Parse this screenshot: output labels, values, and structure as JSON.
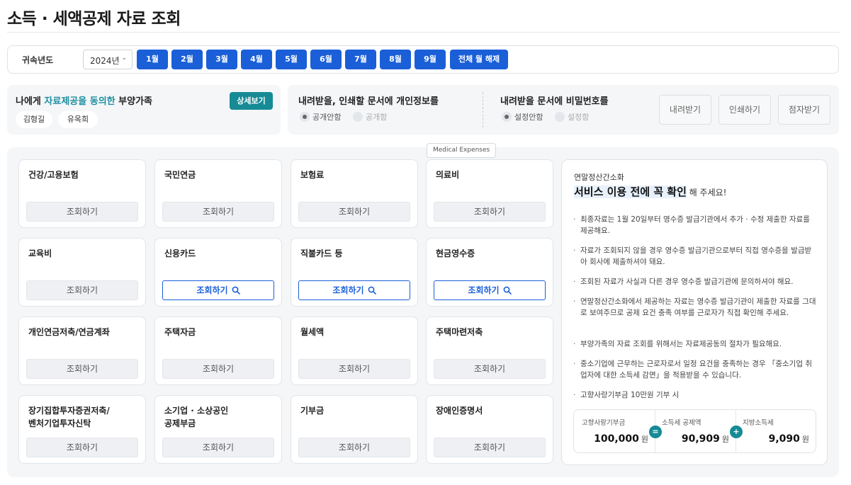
{
  "page": {
    "title": "소득 · 세액공제 자료 조회"
  },
  "yearbar": {
    "label": "귀속년도",
    "year": "2024년",
    "months": [
      "1월",
      "2월",
      "3월",
      "4월",
      "5월",
      "6월",
      "7월",
      "8월",
      "9월"
    ],
    "clear_label": "전체 월 해제",
    "accent": "#1a5fd8"
  },
  "family": {
    "title_prefix": "나에게 ",
    "title_highlight": "자료제공을 동의한",
    "title_suffix": " 부양가족",
    "detail_label": "상세보기",
    "members": [
      "김형길",
      "유옥희"
    ]
  },
  "options": {
    "privacy": {
      "title": "내려받을, 인쇄할 문서에 개인정보를",
      "opt_on": "공개안함",
      "opt_off": "공개함",
      "selected": "공개안함"
    },
    "password": {
      "title": "내려받을 문서에 비밀번호를",
      "opt_on": "설정안함",
      "opt_off": "설정함",
      "selected": "설정안함"
    },
    "download_label": "내려받기",
    "print_label": "인쇄하기",
    "braille_label": "점자받기"
  },
  "categories": [
    {
      "title": "건강/고용보험",
      "button": "조회하기",
      "active": false
    },
    {
      "title": "국민연금",
      "button": "조회하기",
      "active": false
    },
    {
      "title": "보험료",
      "button": "조회하기",
      "active": false
    },
    {
      "title": "의료비",
      "button": "조회하기",
      "active": false
    },
    {
      "title": "교육비",
      "button": "조회하기",
      "active": false
    },
    {
      "title": "신용카드",
      "button": "조회하기",
      "active": true
    },
    {
      "title": "직불카드 등",
      "button": "조회하기",
      "active": true
    },
    {
      "title": "현금영수증",
      "button": "조회하기",
      "active": true
    },
    {
      "title": "개인연금저축/연금계좌",
      "button": "조회하기",
      "active": false
    },
    {
      "title": "주택자금",
      "button": "조회하기",
      "active": false
    },
    {
      "title": "월세액",
      "button": "조회하기",
      "active": false
    },
    {
      "title": "주택마련저축",
      "button": "조회하기",
      "active": false
    },
    {
      "title": "장기집합투자증권저축/\n벤처기업투자신탁",
      "button": "조회하기",
      "active": false
    },
    {
      "title": "소기업 · 소상공인\n공제부금",
      "button": "조회하기",
      "active": false
    },
    {
      "title": "기부금",
      "button": "조회하기",
      "active": false
    },
    {
      "title": "장애인증명서",
      "button": "조회하기",
      "active": false
    }
  ],
  "tooltip": "Medical Expenses",
  "notice": {
    "subtitle": "연말정산간소화",
    "heading_mark": "서비스 이용 전에 꼭 확인",
    "heading_tail": " 해 주세요!",
    "bullets": [
      "최종자료는 1월 20일부터 영수증 발급기관에서 추가 · 수정 제출한 자료를 제공해요.",
      "자료가 조회되지 않을 경우 영수증 발급기관으로부터 직접 영수증을 발급받아 회사에 제출하셔야 돼요.",
      "조회된 자료가 사실과 다른 경우 영수증 발급기관에 문의하셔야 해요.",
      "연말정산간소화에서 제공하는 자료는 영수증 발급기관이 제출한 자료를 그대로 보여주므로 공제 요건 충족 여부를 근로자가 직접 확인해 주세요.",
      "부양가족의 자료 조회를 위해서는 자료제공동의 절차가 필요해요.",
      "중소기업에 근무하는 근로자로서 일정 요건을 충족하는 경우 「중소기업 취업자에 대한 소득세 감면」을 적용받을 수 있습니다.",
      "고향사랑기부금 10만원 기부 시"
    ],
    "calc": {
      "col1_label": "고향사랑기부금",
      "col1_value": "100,000",
      "col1_unit": "원",
      "op1": "=",
      "col2_label": "소득세 공제액",
      "col2_value": "90,909",
      "col2_unit": "원",
      "op2": "+",
      "col3_label": "지방소득세",
      "col3_value": "9,090",
      "col3_unit": "원"
    }
  }
}
